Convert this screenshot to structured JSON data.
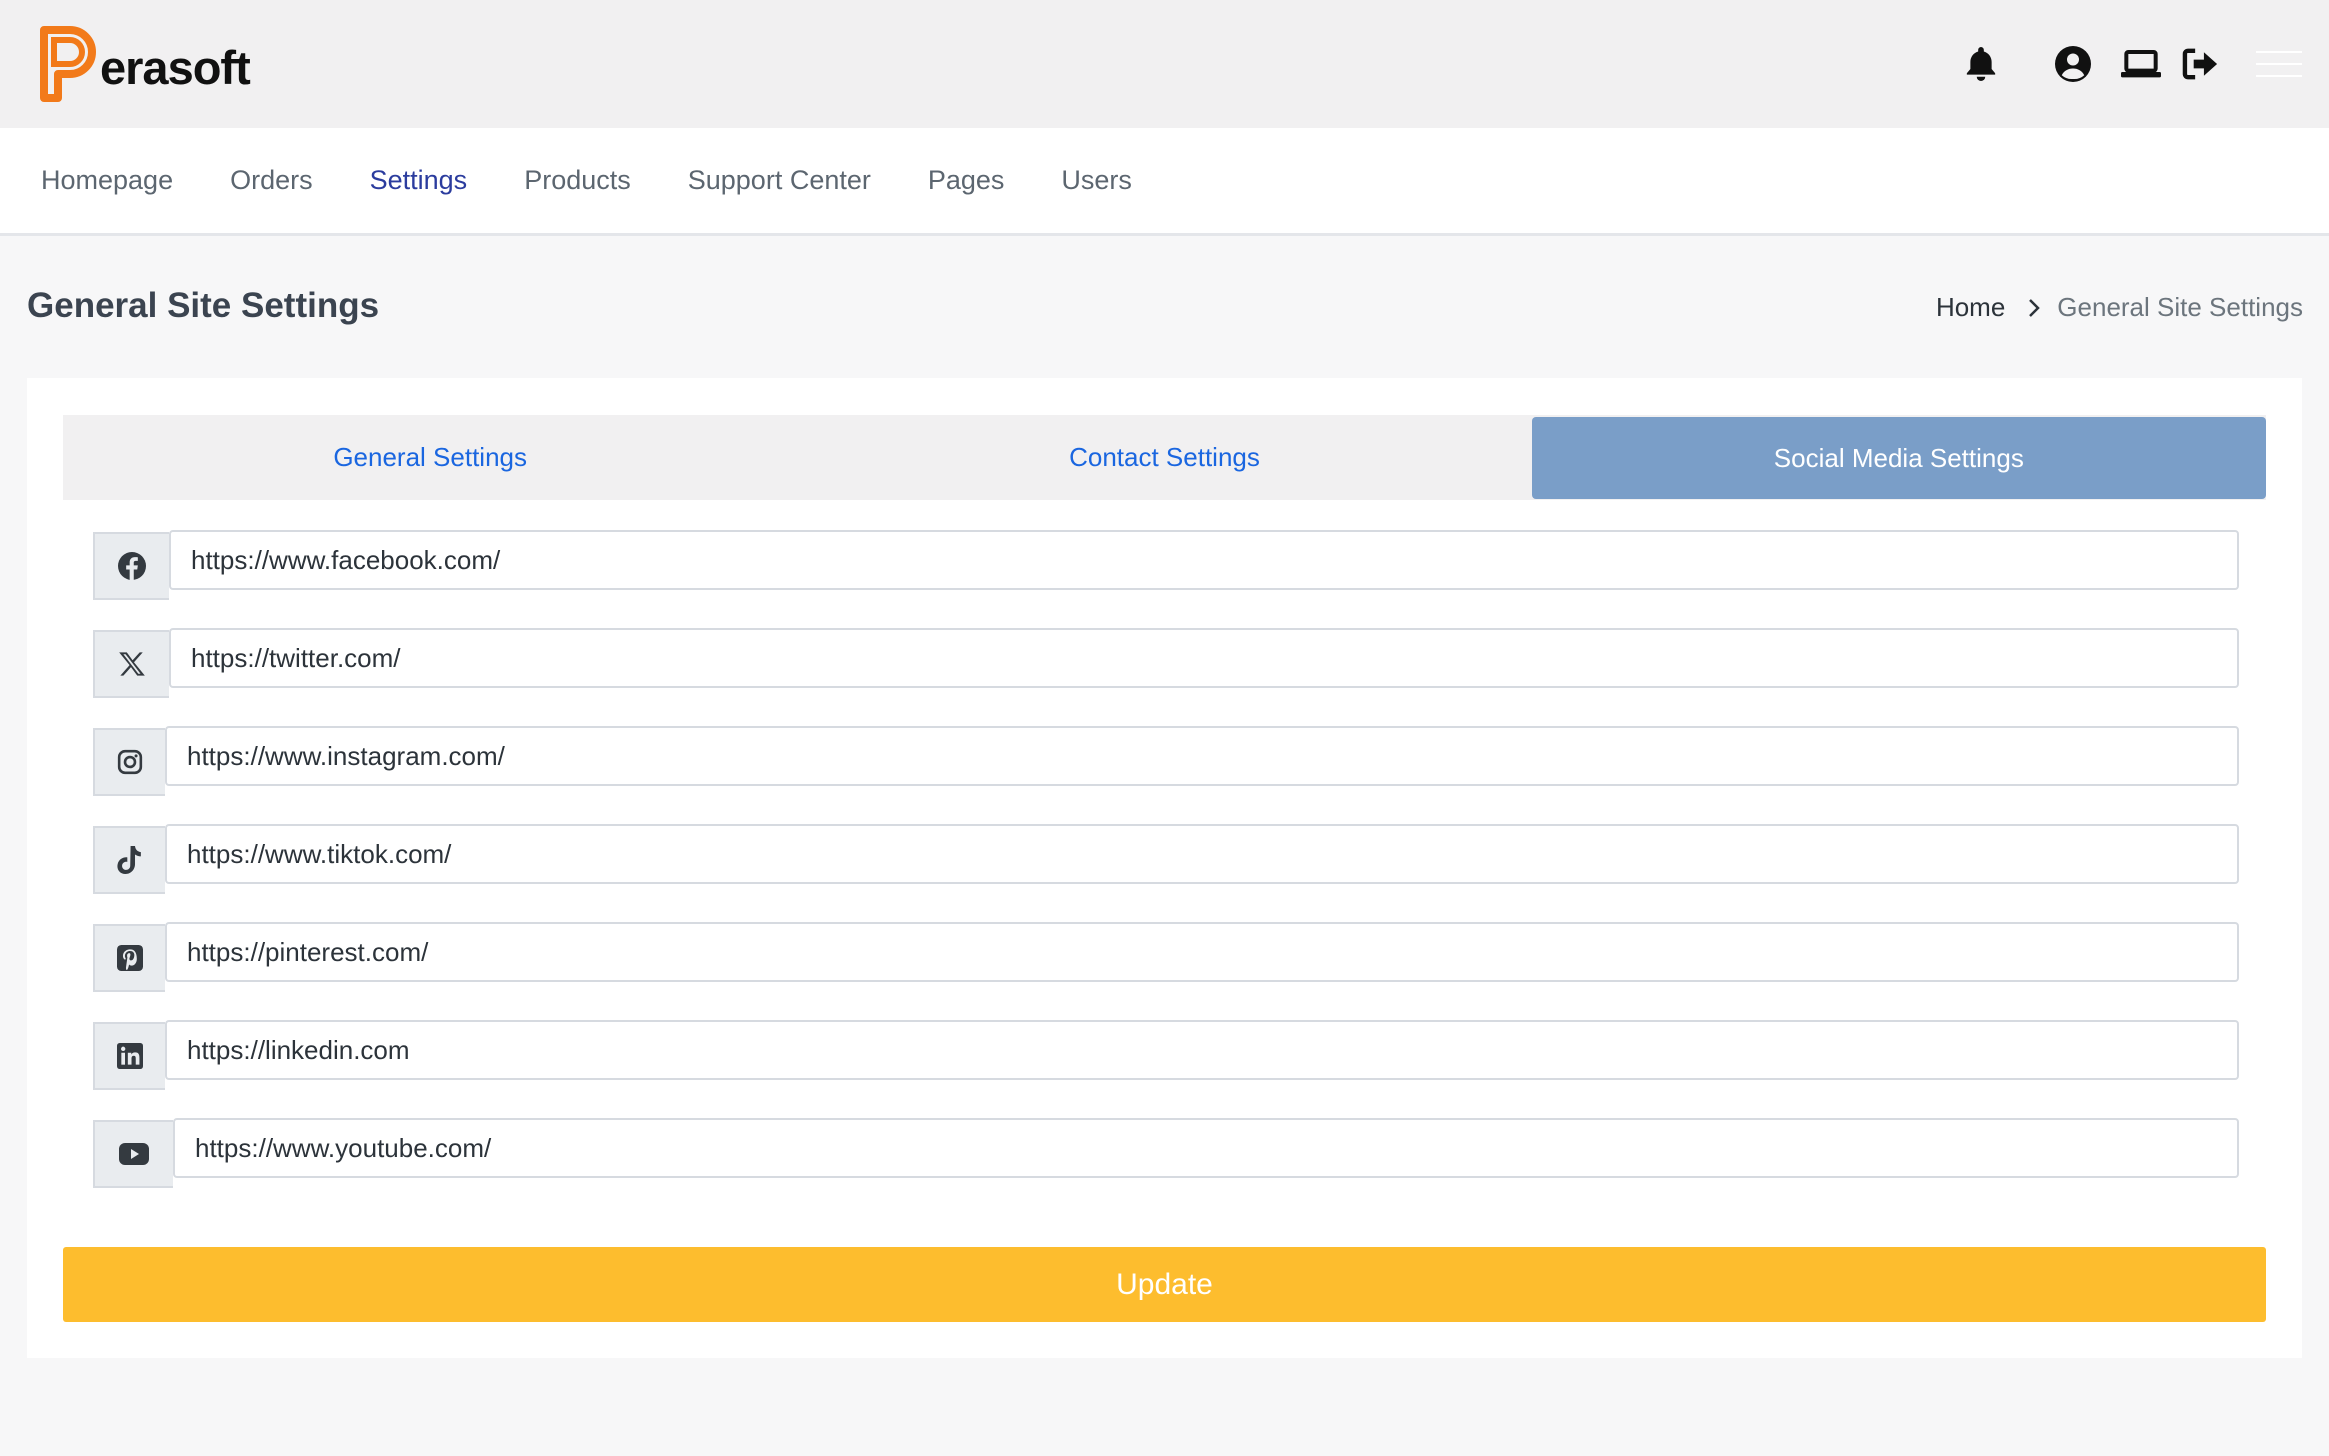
{
  "header": {
    "brand_name": "erasoft",
    "brand_color": "#f27a1a",
    "icons": [
      "bell-icon",
      "user-circle-icon",
      "laptop-icon",
      "logout-icon",
      "menu-icon"
    ]
  },
  "nav": {
    "items": [
      {
        "label": "Homepage"
      },
      {
        "label": "Orders"
      },
      {
        "label": "Settings",
        "active": true
      },
      {
        "label": "Products"
      },
      {
        "label": "Support Center"
      },
      {
        "label": "Pages"
      },
      {
        "label": "Users"
      }
    ]
  },
  "page": {
    "title": "General Site Settings",
    "breadcrumb": {
      "home": "Home",
      "current": "General Site Settings"
    }
  },
  "tabs": [
    {
      "label": "General Settings"
    },
    {
      "label": "Contact Settings"
    },
    {
      "label": "Social Media Settings",
      "active": true
    }
  ],
  "social": [
    {
      "icon": "facebook-icon",
      "value": "https://www.facebook.com/"
    },
    {
      "icon": "x-twitter-icon",
      "value": "https://twitter.com/"
    },
    {
      "icon": "instagram-icon",
      "value": "https://www.instagram.com/"
    },
    {
      "icon": "tiktok-icon",
      "value": "https://www.tiktok.com/"
    },
    {
      "icon": "pinterest-icon",
      "value": "https://pinterest.com/"
    },
    {
      "icon": "linkedin-icon",
      "value": "https://linkedin.com"
    },
    {
      "icon": "youtube-icon",
      "value": "https://www.youtube.com/"
    }
  ],
  "update_label": "Update",
  "colors": {
    "active_tab": "#7a9ec8",
    "update_button": "#fdbd2e",
    "tab_link": "#1a66e0",
    "nav_active": "#2b3c9e"
  }
}
